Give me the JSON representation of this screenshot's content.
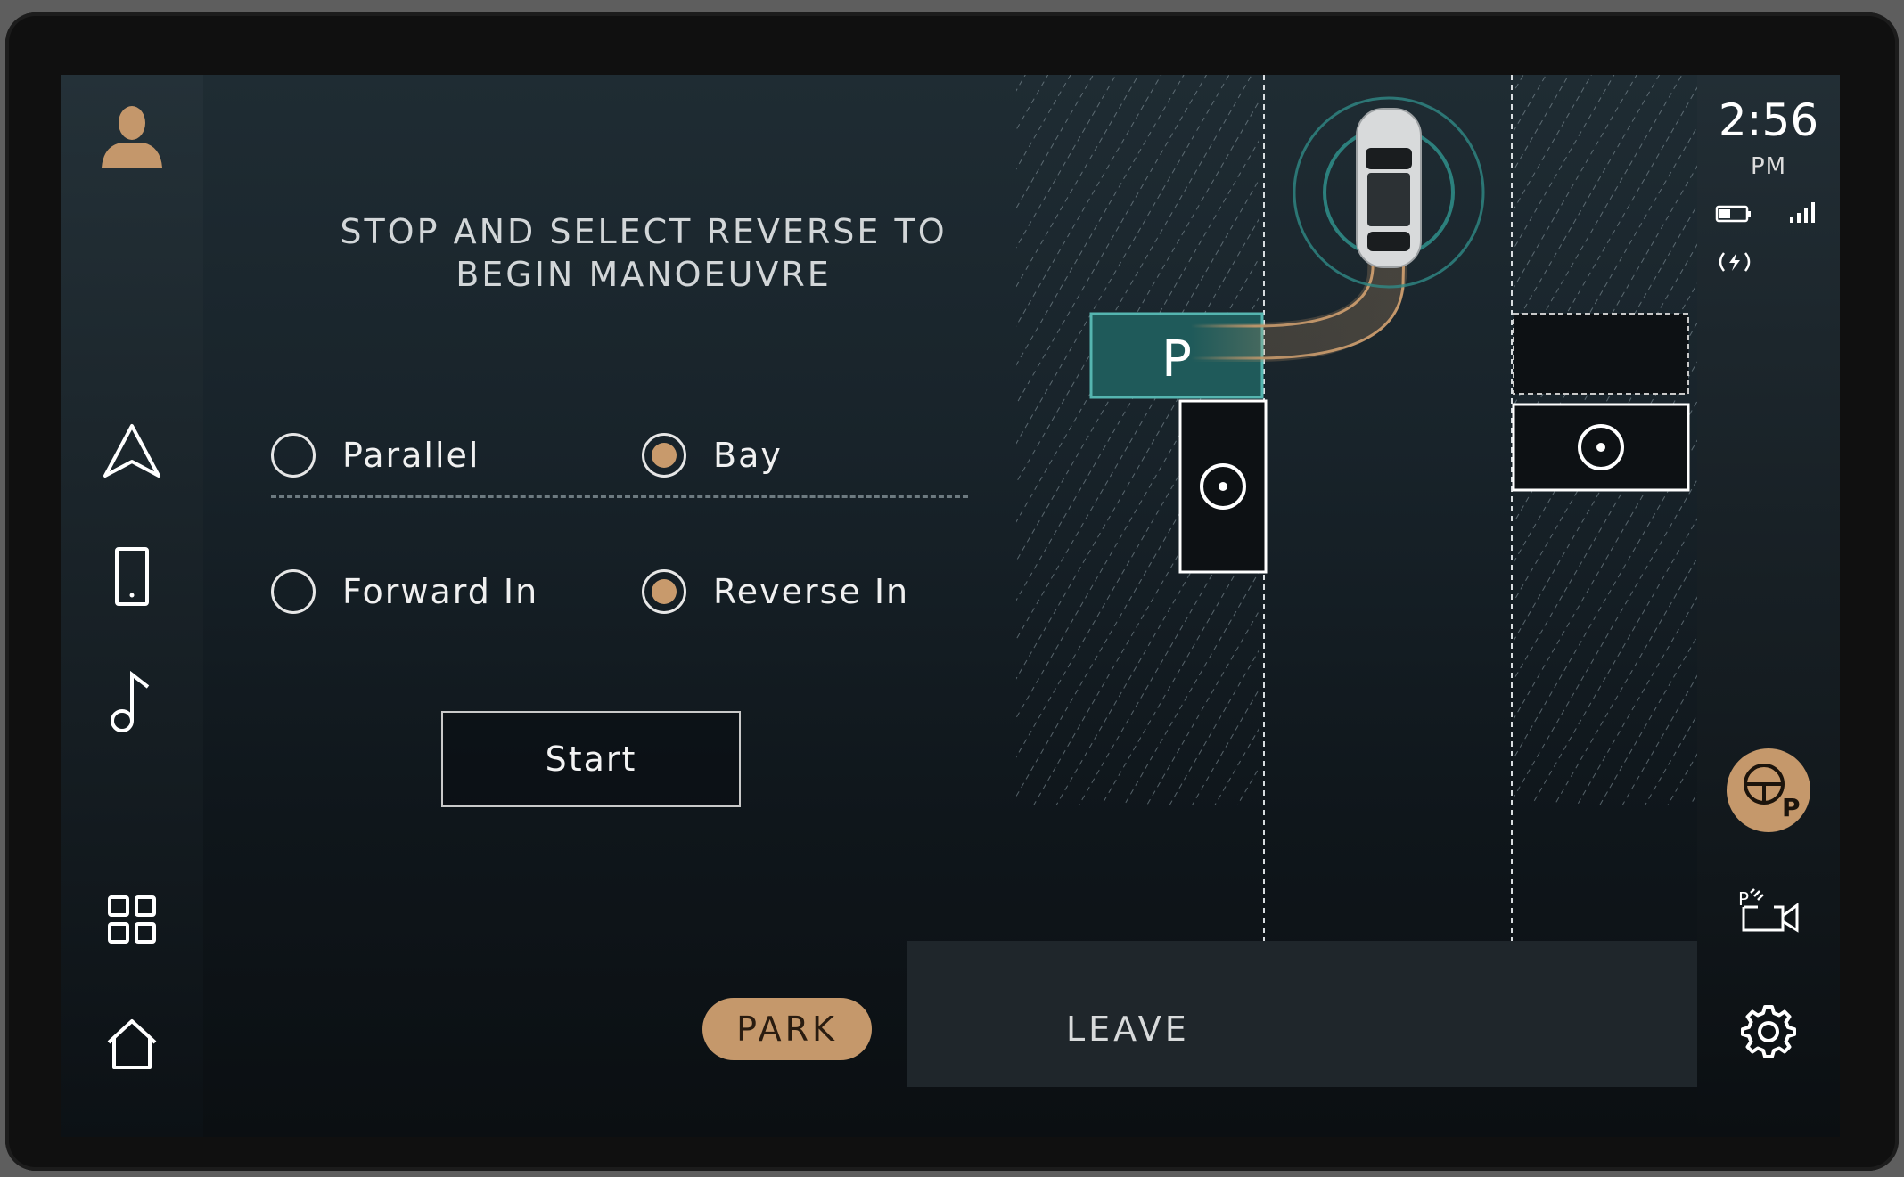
{
  "screen": {
    "instruction_line1": "STOP AND SELECT REVERSE TO",
    "instruction_line2": "BEGIN MANOEUVRE"
  },
  "options": [
    {
      "label": "Parallel",
      "selected": false
    },
    {
      "label": "Bay",
      "selected": true
    },
    {
      "label": "Forward In",
      "selected": false
    },
    {
      "label": "Reverse In",
      "selected": true
    }
  ],
  "start_label": "Start",
  "tabs": {
    "park": "PARK",
    "leave": "LEAVE"
  },
  "target_space_label": "P",
  "status": {
    "time": "2:56",
    "ampm": "PM"
  },
  "colors": {
    "accent": "#c5986b",
    "target_space": "#1f5a5a",
    "sensor": "#2f8a86"
  },
  "icons": {
    "left_nav": [
      "profile-icon",
      "navigation-icon",
      "phone-icon",
      "music-icon",
      "apps-icon",
      "home-icon"
    ],
    "right_rail": [
      "battery-icon",
      "signal-icon",
      "wireless-charging-icon",
      "park-assist-icon",
      "parking-camera-icon",
      "settings-icon"
    ]
  }
}
